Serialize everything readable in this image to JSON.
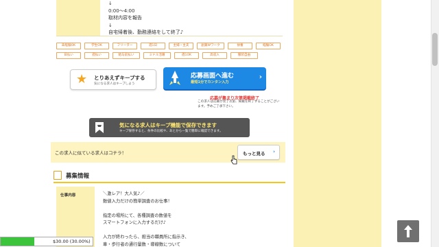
{
  "schedule": {
    "lines": "↓\n0:00〜4:00\n取材内容を報告\n↓\n自宅帰着後、勤務連絡をして終了♪"
  },
  "tags": [
    "未経験OK",
    "学生OK",
    "フリーター",
    "週1日",
    "主婦・主夫",
    "副業Wワーク",
    "扶養",
    "経験OK",
    "日払い",
    "週払い",
    "給与前払い",
    "ミドル活躍",
    "週1OK",
    "高収入",
    "服装自由"
  ],
  "keep_button": {
    "title": "とりあえずキープする",
    "sub": "気になる求人はキープしよう",
    "icon": "star-icon"
  },
  "apply_button": {
    "title": "応募画面へ進む",
    "sub": "最短1分でカンタン入力",
    "arrow": "›",
    "color": "#1e88e5"
  },
  "notice": {
    "red": "応募が集まり次第掲載終了",
    "sub": "この求人は応募が完了次第、掲載を終了することがございます。予めご了承下さい。"
  },
  "keep_banner": {
    "title": "気になる求人はキープ機能で保存できます",
    "sub": "キープ保存すると、条件の比較や、あとから一覧で簡単に確認できます。"
  },
  "similar": {
    "text": "この求人に似ている求人はコチラ！",
    "button": "もっと見る",
    "arrow": "›"
  },
  "recruit": {
    "title": "募集情報",
    "job_label": "仕事内容",
    "job_text": "＼激レア！大人気♪／\n数値入力だけの簡単調査のお仕事！\n\n指定の場所にて、各種調査の数値を\nスマートフォンに入力するだけ♪\n\n入力が終わったら、担当の職員所に指示き、\n車・歩行者の通行量数・導線数について"
  },
  "progress": {
    "label": "$30.00 (30.00%)",
    "fraction": 0.3
  },
  "colors": {
    "side_bg": "#fbf1b5",
    "accent_blue": "#1e88e5",
    "tag_orange": "#e9a760"
  }
}
